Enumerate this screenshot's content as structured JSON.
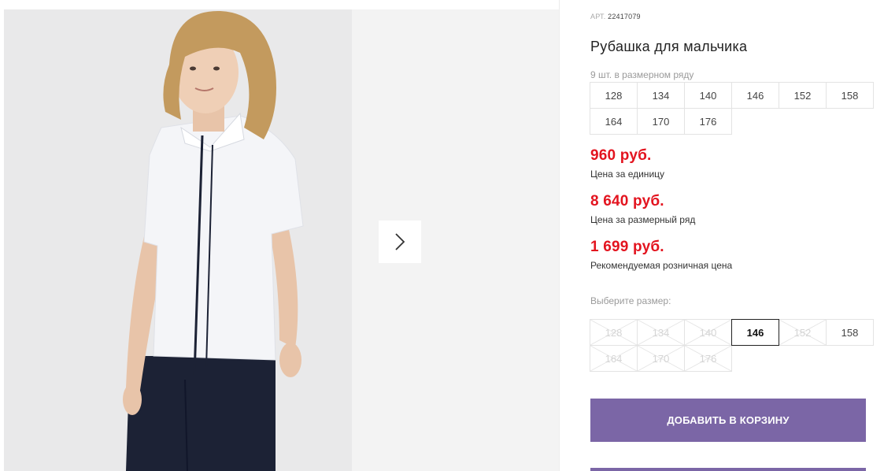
{
  "product": {
    "sku_label": "АРТ.",
    "sku_value": "22417079",
    "title": "Рубашка для мальчика",
    "pack_note": "9 шт. в размерном ряду",
    "pack_sizes": [
      "128",
      "134",
      "140",
      "146",
      "152",
      "158",
      "164",
      "170",
      "176"
    ]
  },
  "prices": [
    {
      "value": "960 руб.",
      "label": "Цена за единицу"
    },
    {
      "value": "8 640 руб.",
      "label": "Цена за размерный ряд"
    },
    {
      "value": "1 699 руб.",
      "label": "Рекомендуемая розничная цена"
    }
  ],
  "size_picker": {
    "label": "Выберите размер:",
    "sizes": [
      {
        "size": "128",
        "state": "disabled"
      },
      {
        "size": "134",
        "state": "disabled"
      },
      {
        "size": "140",
        "state": "disabled"
      },
      {
        "size": "146",
        "state": "selected"
      },
      {
        "size": "152",
        "state": "disabled"
      },
      {
        "size": "158",
        "state": "available"
      },
      {
        "size": "164",
        "state": "disabled"
      },
      {
        "size": "170",
        "state": "disabled"
      },
      {
        "size": "176",
        "state": "disabled"
      }
    ]
  },
  "actions": {
    "add_to_cart": "ДОБАВИТЬ В КОРЗИНУ"
  },
  "icons": {
    "next": "chevron-right-icon"
  },
  "colors": {
    "price": "#e3141f",
    "button": "#7b66a6"
  }
}
